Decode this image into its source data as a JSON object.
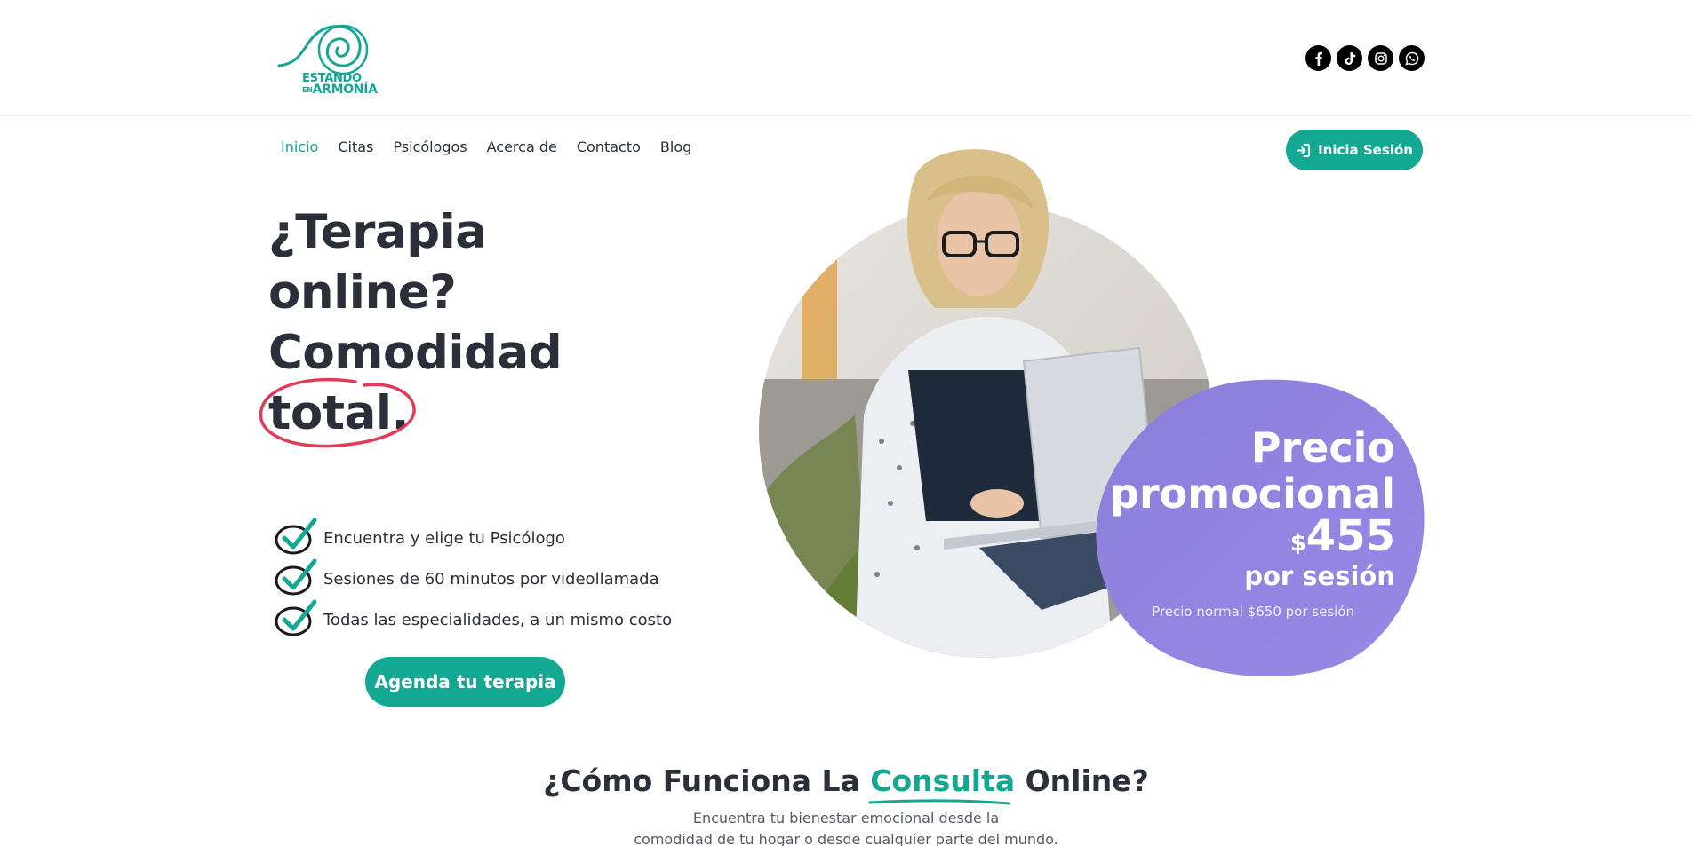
{
  "logo": {
    "line1": "ESTANDO",
    "line2_small": "EN",
    "line2": "ARMONÍA",
    "brand_color": "#14a792"
  },
  "socials": [
    {
      "name": "facebook-icon"
    },
    {
      "name": "tiktok-icon"
    },
    {
      "name": "instagram-icon"
    },
    {
      "name": "whatsapp-icon"
    }
  ],
  "nav": {
    "items": [
      {
        "label": "Inicio",
        "active": true
      },
      {
        "label": "Citas"
      },
      {
        "label": "Psicólogos"
      },
      {
        "label": "Acerca de"
      },
      {
        "label": "Contacto"
      },
      {
        "label": "Blog"
      }
    ],
    "login_label": "Inicia Sesión"
  },
  "hero": {
    "title_lines": [
      "¿Terapia",
      "online?",
      "Comodidad",
      "total."
    ],
    "checks": [
      "Encuentra y elige tu Psicólogo",
      "Sesiones de 60 minutos por videollamada",
      "Todas las especialidades, a un mismo costo"
    ],
    "cta_label": "Agenda tu terapia"
  },
  "promo": {
    "line1": "Precio",
    "line2": "promocional",
    "currency": "$",
    "price": "455",
    "per": "por sesión",
    "normal": "Precio normal $650 por sesión",
    "badge_color": "#8f82e3"
  },
  "how": {
    "title_pre": "¿Cómo Funciona La",
    "title_accent": "Consulta",
    "title_post": "Online?",
    "sub_line1": "Encuentra tu bienestar emocional desde la",
    "sub_line2": "comodidad de tu hogar o desde cualquier parte del mundo."
  },
  "colors": {
    "accent": "#12a892",
    "text": "#2b2f3a",
    "circle_highlight": "#e23b5a"
  }
}
